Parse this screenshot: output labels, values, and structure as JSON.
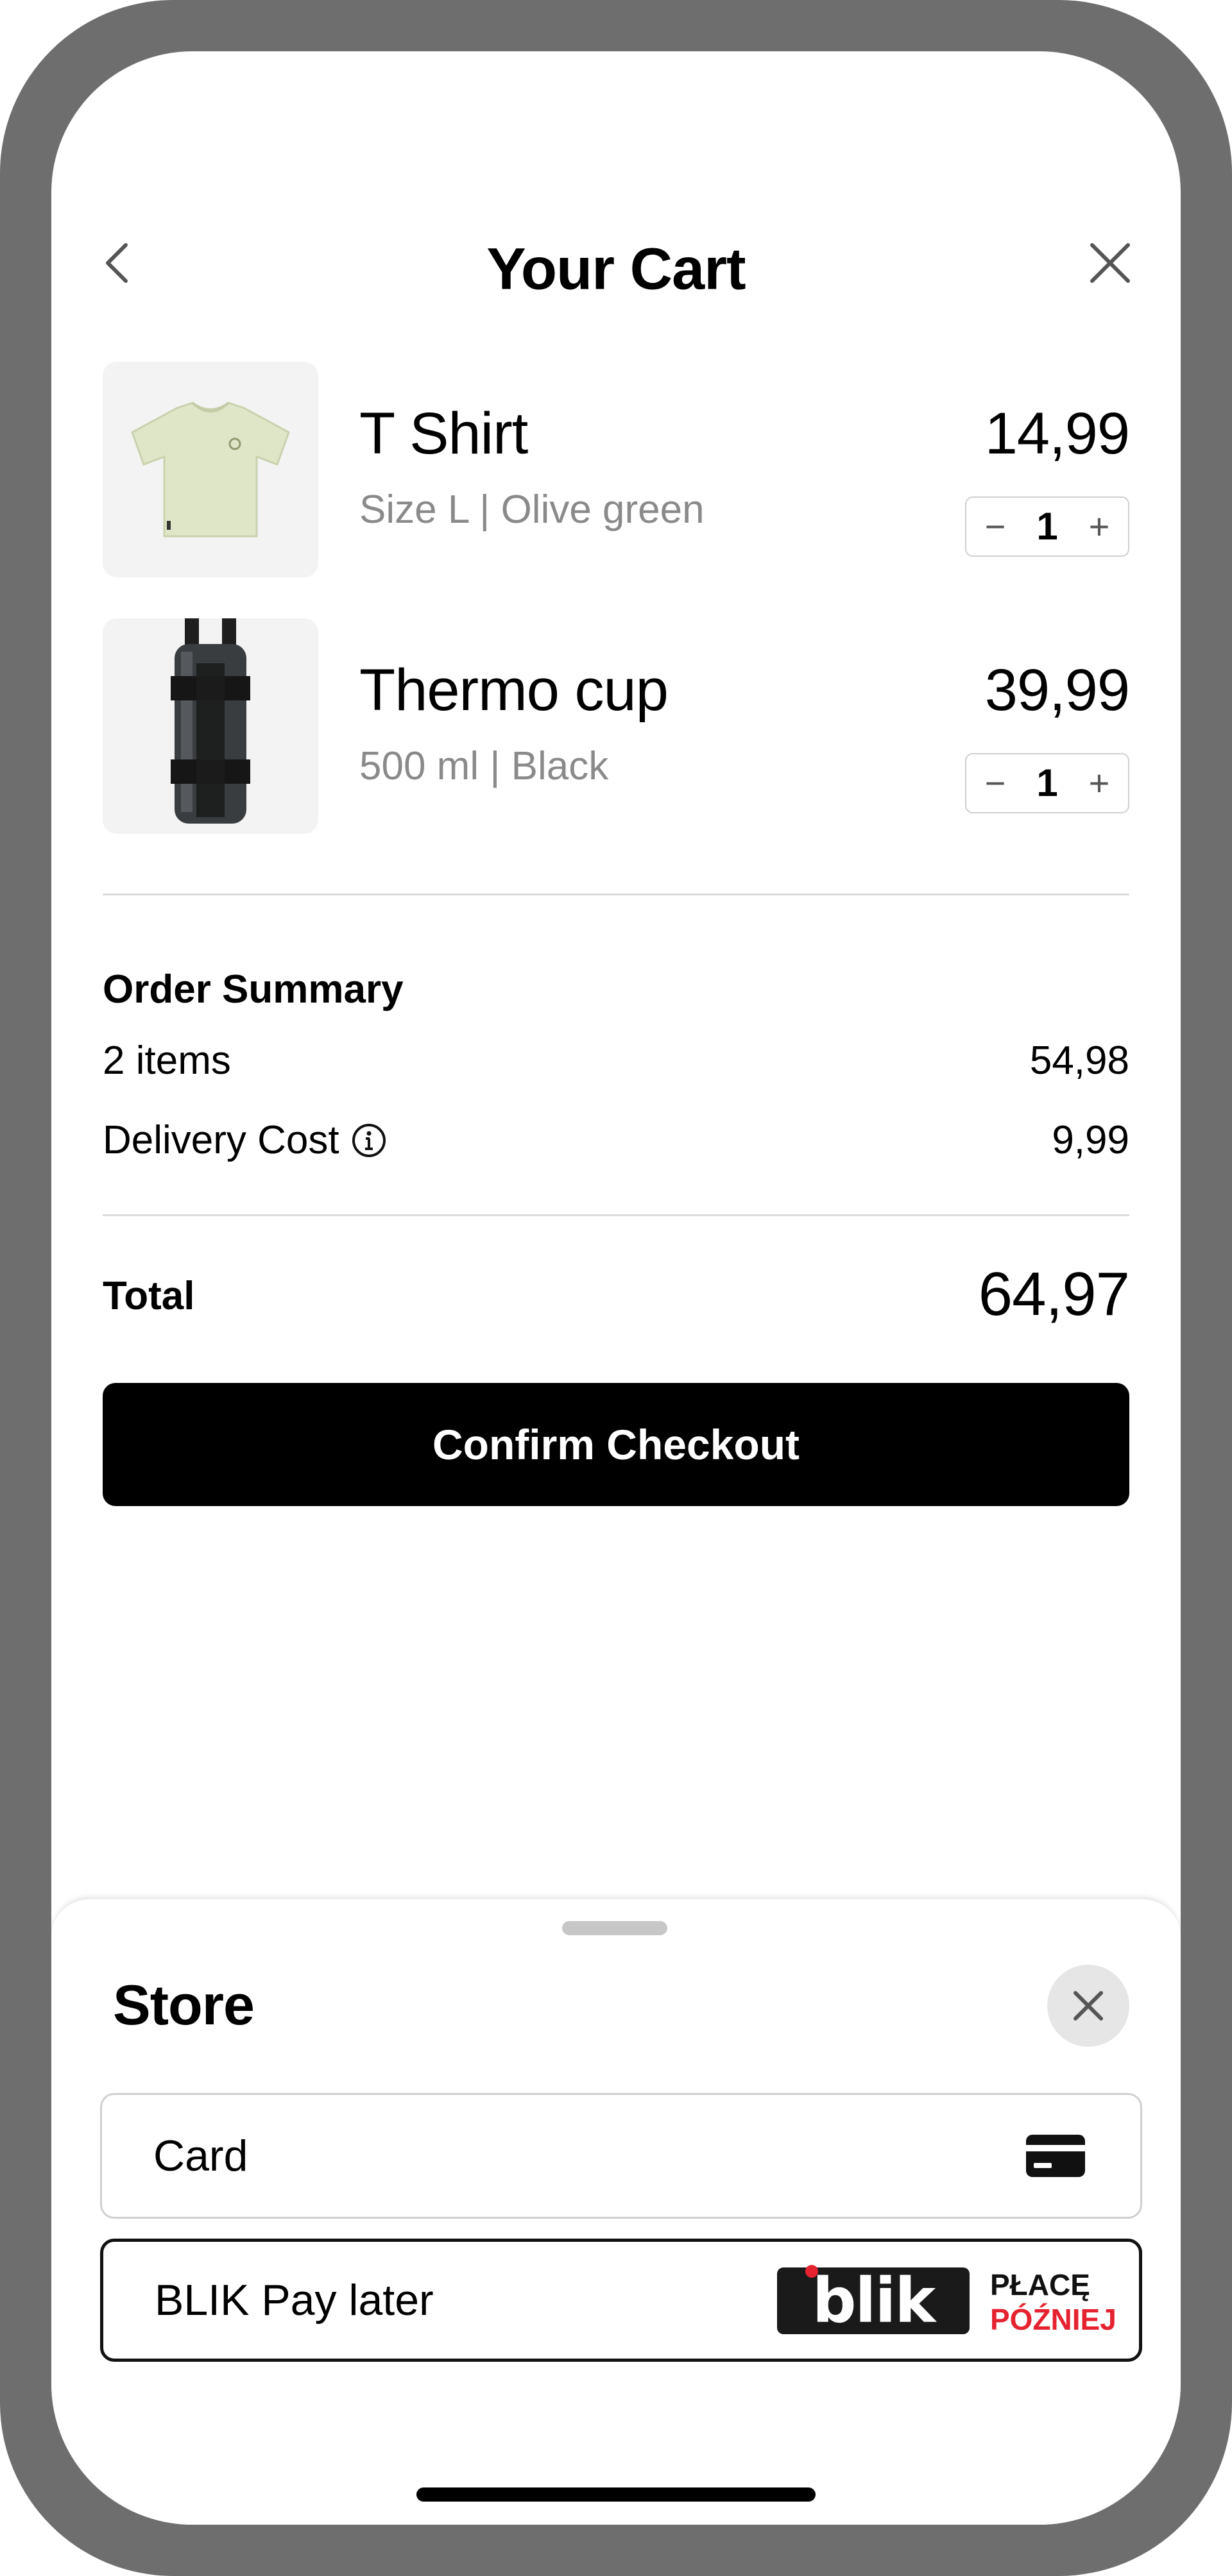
{
  "header": {
    "title": "Your Cart"
  },
  "cart": {
    "items": [
      {
        "name": "T Shirt",
        "details": "Size L | Olive green",
        "price": "14,99",
        "quantity": "1",
        "decrement": "−",
        "increment": "+"
      },
      {
        "name": "Thermo cup",
        "details": "500 ml | Black",
        "price": "39,99",
        "quantity": "1",
        "decrement": "−",
        "increment": "+"
      }
    ]
  },
  "summary": {
    "title": "Order Summary",
    "items_label": "2 items",
    "items_value": "54,98",
    "delivery_label": "Delivery Cost",
    "delivery_value": "9,99",
    "total_label": "Total",
    "total_value": "64,97"
  },
  "checkout_button": "Confirm Checkout",
  "sheet": {
    "title": "Store",
    "options": [
      {
        "label": "Card",
        "icon": "credit-card-icon"
      },
      {
        "label": "BLIK Pay later",
        "logo_text": "blik",
        "badge_line1": "PŁACĘ",
        "badge_line2": "PÓŹNIEJ"
      }
    ]
  },
  "colors": {
    "frame": "#6e6e6e",
    "primary_button": "#000000",
    "blik_red": "#e5222f",
    "muted_text": "#8a8a8a"
  }
}
